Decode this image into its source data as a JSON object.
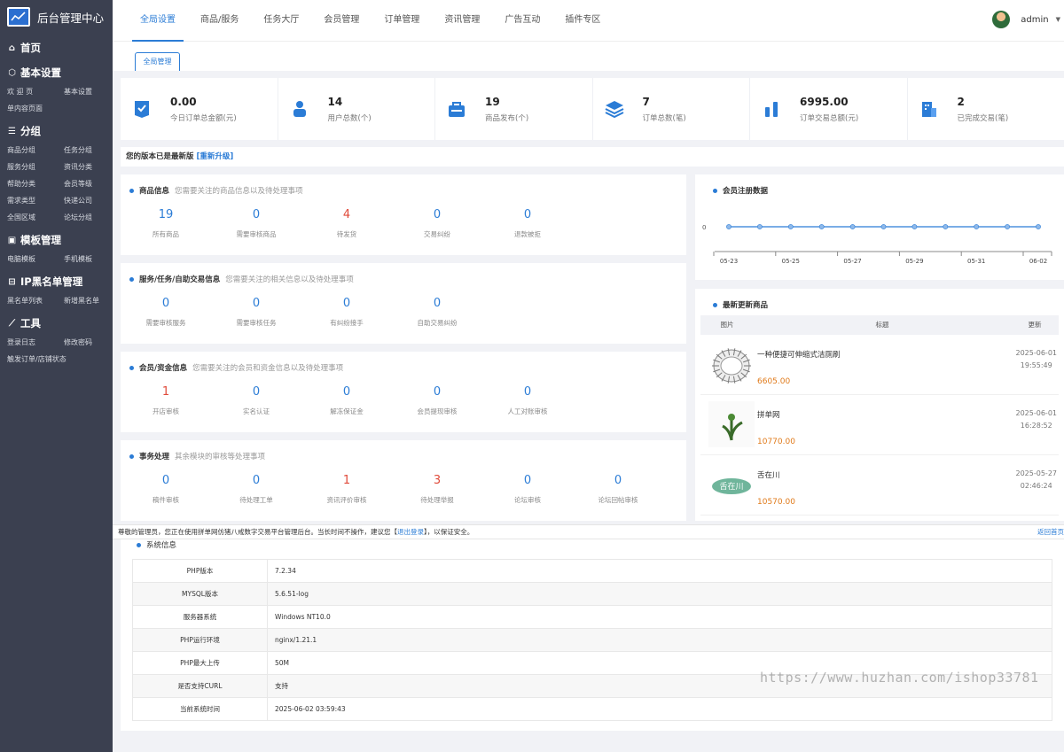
{
  "app": {
    "title": "后台管理中心"
  },
  "sidebar": {
    "sections": [
      {
        "title": "首页",
        "icon": "home-icon",
        "items": []
      },
      {
        "title": "基本设置",
        "icon": "cube-icon",
        "items": [
          "欢 迎 页",
          "基本设置",
          "单内容页面"
        ]
      },
      {
        "title": "分组",
        "icon": "list-icon",
        "items": [
          "商品分组",
          "任务分组",
          "服务分组",
          "资讯分类",
          "帮助分类",
          "会员等级",
          "需求类型",
          "快递公司",
          "全国区域",
          "论坛分组"
        ]
      },
      {
        "title": "模板管理",
        "icon": "template-icon",
        "items": [
          "电脑模板",
          "手机模板"
        ]
      },
      {
        "title": "IP黑名单管理",
        "icon": "ip-icon",
        "items": [
          "黑名单列表",
          "新增黑名单"
        ]
      },
      {
        "title": "工具",
        "icon": "tools-icon",
        "items": [
          "登录日志",
          "修改密码",
          "触发订单/店铺状态"
        ]
      }
    ]
  },
  "topnav": {
    "tabs": [
      "全局设置",
      "商品/服务",
      "任务大厅",
      "会员管理",
      "订单管理",
      "资讯管理",
      "广告互动",
      "插件专区"
    ],
    "active": 0
  },
  "user": {
    "name": "admin"
  },
  "subtab": "全局管理",
  "stats": [
    {
      "value": "0.00",
      "label": "今日订单总金额(元)",
      "icon": "wallet-check-icon"
    },
    {
      "value": "14",
      "label": "用户总数(个)",
      "icon": "users-icon"
    },
    {
      "value": "19",
      "label": "商品发布(个)",
      "icon": "bag-icon"
    },
    {
      "value": "7",
      "label": "订单总数(笔)",
      "icon": "layers-icon"
    },
    {
      "value": "6995.00",
      "label": "订单交易总额(元)",
      "icon": "bar-chart-icon"
    },
    {
      "value": "2",
      "label": "已完成交易(笔)",
      "icon": "building-icon"
    }
  ],
  "version": {
    "text": "您的版本已是最新版",
    "link": "[重新升级]"
  },
  "panels": [
    {
      "title": "商品信息",
      "desc": "您需要关注的商品信息以及待处理事项",
      "items": [
        {
          "value": "19",
          "label": "所有商品",
          "red": false
        },
        {
          "value": "0",
          "label": "需要审核商品",
          "red": false
        },
        {
          "value": "4",
          "label": "待发货",
          "red": true
        },
        {
          "value": "0",
          "label": "交易纠纷",
          "red": false
        },
        {
          "value": "0",
          "label": "退款被拒",
          "red": false
        }
      ]
    },
    {
      "title": "服务/任务/自助交易信息",
      "desc": "您需要关注的相关信息以及待处理事项",
      "items": [
        {
          "value": "0",
          "label": "需要审核服务",
          "red": false
        },
        {
          "value": "0",
          "label": "需要审核任务",
          "red": false
        },
        {
          "value": "0",
          "label": "有纠纷接手",
          "red": false
        },
        {
          "value": "0",
          "label": "自助交易纠纷",
          "red": false
        }
      ]
    },
    {
      "title": "会员/资金信息",
      "desc": "您需要关注的会员和资金信息以及待处理事项",
      "items": [
        {
          "value": "1",
          "label": "开店审核",
          "red": true
        },
        {
          "value": "0",
          "label": "实名认证",
          "red": false
        },
        {
          "value": "0",
          "label": "解冻保证金",
          "red": false
        },
        {
          "value": "0",
          "label": "会员提现审核",
          "red": false
        },
        {
          "value": "0",
          "label": "人工对账审核",
          "red": false
        }
      ]
    },
    {
      "title": "事务处理",
      "desc": "其余模块的审核等处理事项",
      "items": [
        {
          "value": "0",
          "label": "稿件审核",
          "red": false
        },
        {
          "value": "0",
          "label": "待处理工单",
          "red": false
        },
        {
          "value": "1",
          "label": "资讯评价审核",
          "red": true
        },
        {
          "value": "3",
          "label": "待处理举报",
          "red": true
        },
        {
          "value": "0",
          "label": "论坛审核",
          "red": false
        },
        {
          "value": "0",
          "label": "论坛回帖审核",
          "red": false
        }
      ]
    }
  ],
  "member_chart": {
    "title": "会员注册数据",
    "chart_data": {
      "type": "line",
      "x": [
        "05-23",
        "05-24",
        "05-25",
        "05-26",
        "05-27",
        "05-28",
        "05-29",
        "05-30",
        "05-31",
        "06-01",
        "06-02"
      ],
      "tick_labels": [
        "05-23",
        "05-25",
        "05-27",
        "05-29",
        "05-31",
        "06-02"
      ],
      "series": [
        {
          "values": [
            0,
            0,
            0,
            0,
            0,
            0,
            0,
            0,
            0,
            0,
            0
          ]
        }
      ],
      "ytick": "0",
      "color": "#2b7cd6"
    }
  },
  "latest": {
    "title": "最新更新商品",
    "columns": [
      "图片",
      "标题",
      "更新"
    ],
    "rows": [
      {
        "title": "一种便捷可伸缩式洁厕刷",
        "price": "6605.00",
        "date": "2025-06-01",
        "time": "19:55:49",
        "img": "brush-icon"
      },
      {
        "title": "拼单网",
        "price": "10770.00",
        "date": "2025-06-01",
        "time": "16:28:52",
        "img": "plant-icon"
      },
      {
        "title": "舌在川",
        "price": "10570.00",
        "date": "2025-05-27",
        "time": "02:46:24",
        "img": "logo-text-icon"
      }
    ]
  },
  "notice": {
    "text": "尊敬的管理员，您正在使用拼单网仿猪八戒数字交易平台管理后台。当长时间不操作，建议您【",
    "link": "退出登录",
    "tail": "】，以保证安全。",
    "back": "返回首页"
  },
  "sysinfo": {
    "title": "系统信息",
    "rows": [
      {
        "key": "PHP版本",
        "value": "7.2.34"
      },
      {
        "key": "MYSQL版本",
        "value": "5.6.51-log"
      },
      {
        "key": "服务器系统",
        "value": "Windows NT10.0"
      },
      {
        "key": "PHP运行环境",
        "value": "nginx/1.21.1"
      },
      {
        "key": "PHP最大上传",
        "value": "50M"
      },
      {
        "key": "是否支持CURL",
        "value": "支持"
      },
      {
        "key": "当前系统时间",
        "value": "2025-06-02 03:59:43"
      }
    ]
  },
  "watermark": "https://www.huzhan.com/ishop33781",
  "colors": {
    "accent": "#2b7cd6",
    "sidebar": "#3b4050",
    "danger": "#e04a3a",
    "price": "#e07a1a"
  }
}
